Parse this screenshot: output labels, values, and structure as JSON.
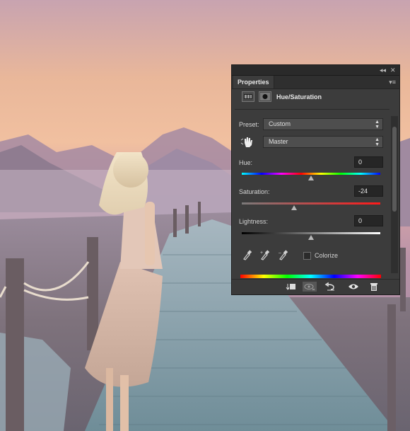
{
  "panel": {
    "collapse_glyph": "◂◂",
    "close_glyph": "✕",
    "tab_label": "Properties",
    "menu_glyph": "▾≡",
    "adjustment_icon": "hue-saturation-adjustment-icon",
    "mask_icon": "layer-mask-icon",
    "adjustment_title": "Hue/Saturation",
    "preset": {
      "label": "Preset:",
      "value": "Custom"
    },
    "channel": {
      "value": "Master",
      "icon": "targeted-adjustment-hand-icon"
    },
    "hue": {
      "label": "Hue:",
      "value": "0",
      "level": 0.5,
      "range": [
        -180,
        180
      ]
    },
    "saturation": {
      "label": "Saturation:",
      "value": "-24",
      "level": 0.38,
      "range": [
        -100,
        100
      ]
    },
    "lightness": {
      "label": "Lightness:",
      "value": "0",
      "level": 0.5,
      "range": [
        -100,
        100
      ]
    },
    "eyedroppers": [
      "eyedropper-icon",
      "eyedropper-plus-icon",
      "eyedropper-minus-icon"
    ],
    "colorize": {
      "label": "Colorize",
      "checked": false
    },
    "footer_icons": [
      "clip-to-layer-icon",
      "view-previous-state-icon",
      "reset-icon",
      "visibility-eye-icon",
      "trash-icon"
    ],
    "colors": {
      "panel_bg": "#3c3c3c",
      "field_bg": "#262626",
      "text": "#d6d6d6"
    }
  }
}
